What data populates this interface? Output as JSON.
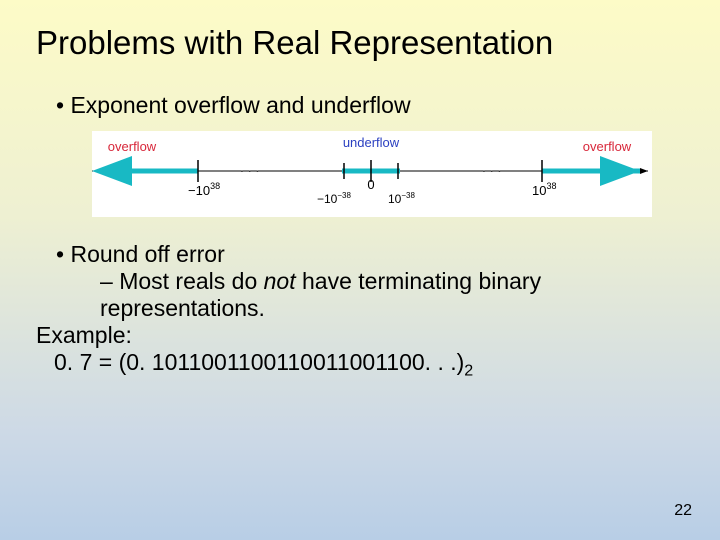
{
  "title": "Problems with Real Representation",
  "bullet1": "Exponent overflow and underflow",
  "figure": {
    "overflow_left": "overflow",
    "underflow": "underflow",
    "overflow_right": "overflow",
    "neg38": "−10",
    "neg38exp": "38",
    "neg38small": "−10",
    "neg38smallexp": "−38",
    "zero": "0",
    "pos38small": "10",
    "pos38smallexp": "−38",
    "pos38": "10",
    "pos38exp": "38"
  },
  "bullet2": "Round off error",
  "sub_start": "Most reals do ",
  "sub_not": "not",
  "sub_end": " have terminating binary representations.",
  "example": "Example:",
  "value": "0. 7 = (0. 1011001100110011001100. . .)",
  "base": "2",
  "pagenum": "22"
}
